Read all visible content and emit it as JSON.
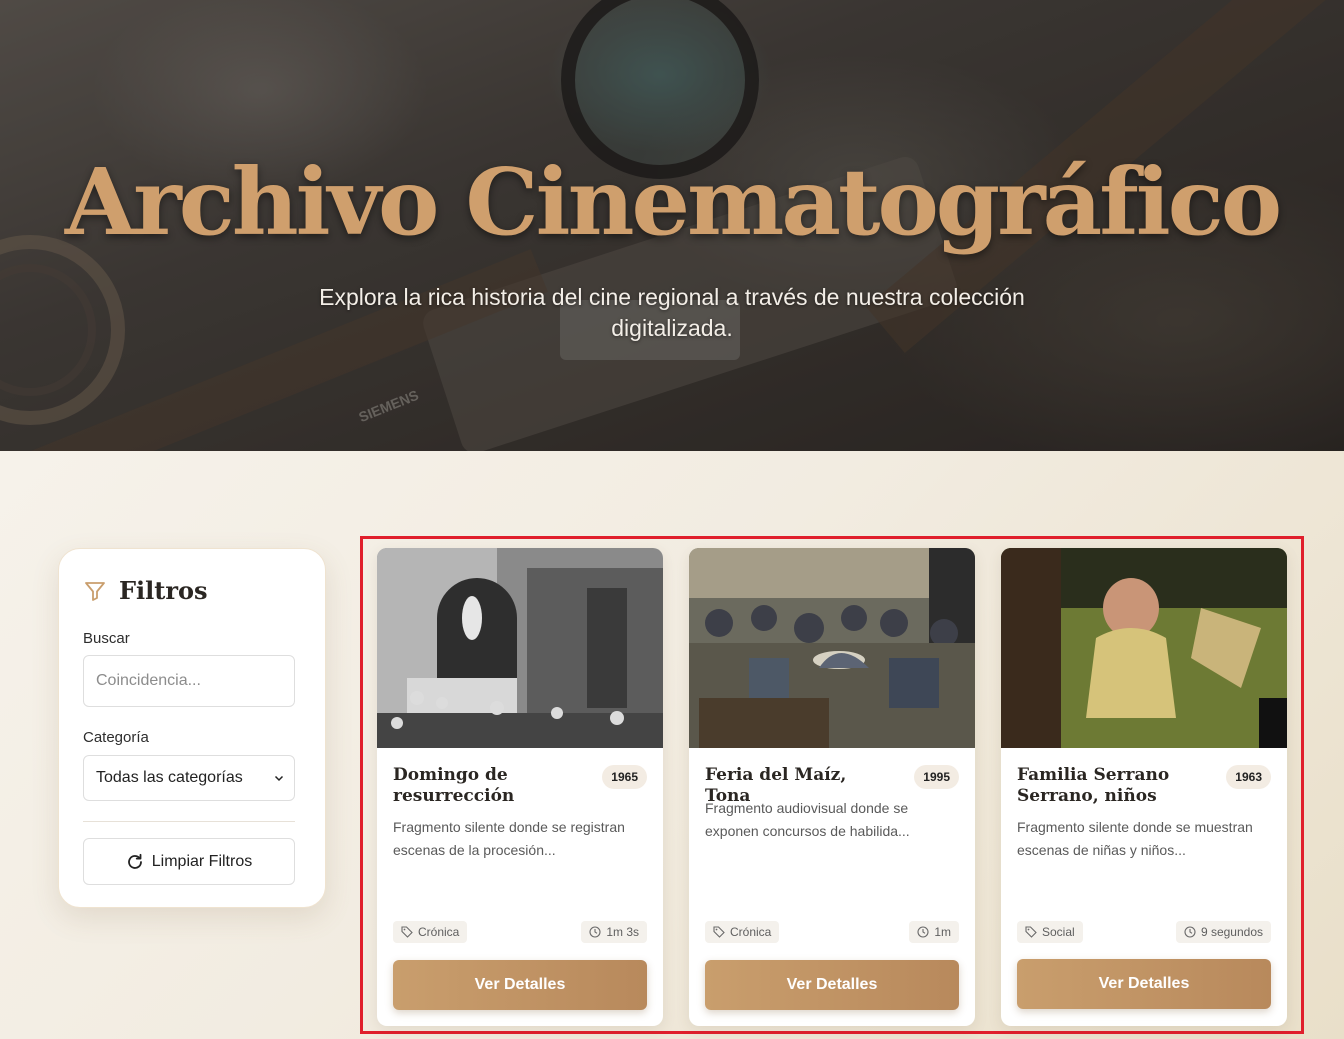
{
  "hero": {
    "title": "Archivo Cinematográfico",
    "subtitle": "Explora la rica historia del cine regional a través de nuestra colección digitalizada.",
    "brand_mark": "SIEMENS"
  },
  "filters": {
    "title": "Filtros",
    "search_label": "Buscar",
    "search_placeholder": "Coincidencia...",
    "search_value": "",
    "category_label": "Categoría",
    "category_selected": "Todas las categorías",
    "clear_label": "Limpiar Filtros"
  },
  "cards": [
    {
      "title": "Domingo de resurrección",
      "year": "1965",
      "description": "Fragmento silente donde se registran escenas de la procesión...",
      "category": "Crónica",
      "duration": "1m 3s",
      "button": "Ver Detalles"
    },
    {
      "title": "Feria del Maíz, Tona",
      "year": "1995",
      "description": "Fragmento audiovisual donde se exponen concursos de habilida...",
      "category": "Crónica",
      "duration": "1m",
      "button": "Ver Detalles"
    },
    {
      "title": "Familia Serrano Serrano, niños",
      "year": "1963",
      "description": "Fragmento silente donde se muestran escenas de niñas y niños...",
      "category": "Social",
      "duration": "9 segundos",
      "button": "Ver Detalles"
    }
  ],
  "icons": {
    "filter": "funnel-icon",
    "refresh": "refresh-icon",
    "tag": "tag-icon",
    "clock": "clock-icon",
    "select": "chevron-down-icon"
  },
  "colors": {
    "accent": "#c99e6d",
    "hero_title": "#cf9f6d",
    "highlight_border": "#e01f2c"
  }
}
